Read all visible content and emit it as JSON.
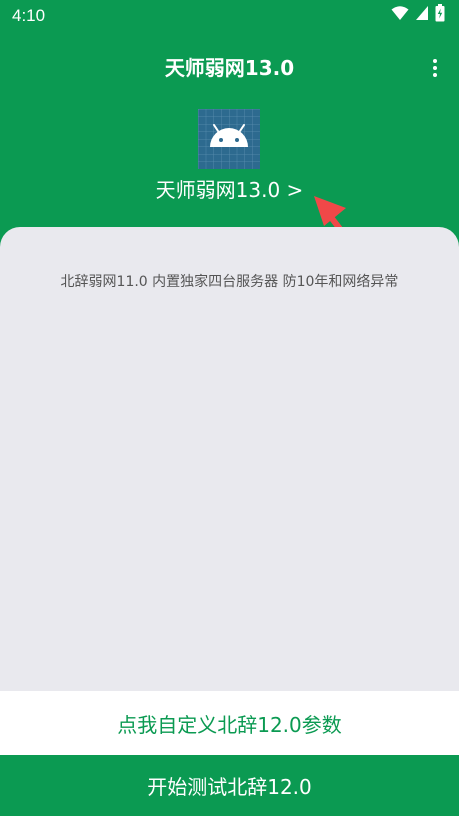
{
  "status_bar": {
    "time": "4:10",
    "icons": [
      "wifi-icon",
      "cellular-signal-icon",
      "battery-charging-icon"
    ]
  },
  "app_bar": {
    "title": "天师弱网13.0",
    "menu_icon": "more-vert-icon"
  },
  "header": {
    "app_icon": "android-icon",
    "version_link": "天师弱网13.0 >",
    "annotation_icon": "red-arrow-icon"
  },
  "content": {
    "description": "北辞弱网11.0 内置独家四台服务器 防10年和网络异常"
  },
  "actions": {
    "customize_label": "点我自定义北辞12.0参数",
    "start_label": "开始测试北辞12.0"
  },
  "colors": {
    "primary": "#0b9a52",
    "card": "#e9e9ee",
    "icon_bg": "#2d6a8f",
    "arrow": "#f04848",
    "white": "#ffffff"
  }
}
